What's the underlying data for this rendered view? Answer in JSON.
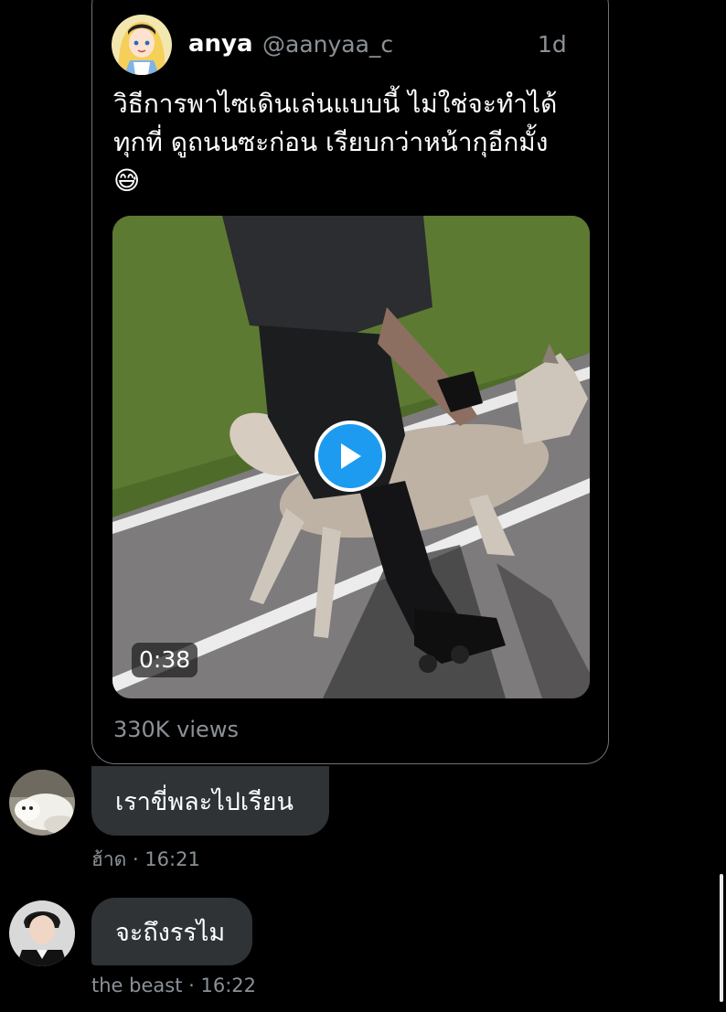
{
  "tweet": {
    "author_name": "anya",
    "author_handle": "@aanyaa_c",
    "time": "1d",
    "text_line1": "วิธีการพาไซเดินเล่นแบบนี้ ไม่ใช่จะทำได้",
    "text_line2": "ทุกที่ ดูถนนซะก่อน เรียบกว่าหน้ากุอีกมั้ง",
    "emoji": "😅",
    "video_duration": "0:38",
    "views": "330K views"
  },
  "messages": [
    {
      "text": "เราขี่พละไปเรียน",
      "sender": "ฮ้าด",
      "time": "· 16:21"
    },
    {
      "text": "จะถึงรรไม",
      "sender": "the beast",
      "time": "· 16:22"
    }
  ],
  "colors": {
    "background": "#000000",
    "bubble": "#2f3336",
    "muted_text": "#8b9196",
    "play_button": "#1d9bf0"
  },
  "icons": [
    "alice-avatar",
    "play-icon",
    "dog-avatar",
    "person-avatar"
  ]
}
